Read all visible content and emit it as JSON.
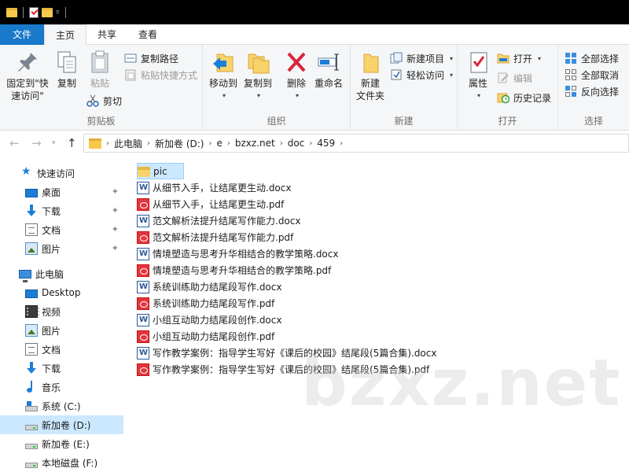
{
  "ribbon_tabs": [
    "文件",
    "主页",
    "共享",
    "查看"
  ],
  "clipboard": {
    "pin_label": "固定到\"快\n速访问\"",
    "copy_label": "复制",
    "paste_label": "粘贴",
    "copy_path": "复制路径",
    "paste_shortcut": "粘贴快捷方式",
    "cut": "剪切",
    "group": "剪贴板"
  },
  "organize": {
    "move_to": "移动到",
    "copy_to": "复制到",
    "delete": "删除",
    "rename": "重命名",
    "group": "组织"
  },
  "new": {
    "new_folder_1": "新建",
    "new_folder_2": "文件夹",
    "new_item": "新建项目",
    "easy_access": "轻松访问",
    "group": "新建"
  },
  "open": {
    "properties": "属性",
    "open": "打开",
    "edit": "编辑",
    "history": "历史记录",
    "group": "打开"
  },
  "select": {
    "select_all": "全部选择",
    "select_none": "全部取消",
    "invert": "反向选择",
    "group": "选择"
  },
  "breadcrumb": [
    "此电脑",
    "新加卷 (D:)",
    "e",
    "bzxz.net",
    "doc",
    "459"
  ],
  "nav": {
    "quick_access": "快速访问",
    "qa_items": [
      "桌面",
      "下载",
      "文档",
      "图片"
    ],
    "this_pc": "此电脑",
    "pc_items": [
      "Desktop",
      "视频",
      "图片",
      "文档",
      "下载",
      "音乐",
      "系统 (C:)",
      "新加卷 (D:)",
      "新加卷 (E:)",
      "本地磁盘 (F:)"
    ]
  },
  "files": [
    {
      "name": "pic",
      "type": "folder"
    },
    {
      "name": "从细节入手，让结尾更生动.docx",
      "type": "docx"
    },
    {
      "name": "从细节入手，让结尾更生动.pdf",
      "type": "pdf"
    },
    {
      "name": "范文解析法提升结尾写作能力.docx",
      "type": "docx"
    },
    {
      "name": "范文解析法提升结尾写作能力.pdf",
      "type": "pdf"
    },
    {
      "name": "情境塑造与思考升华相结合的教学策略.docx",
      "type": "docx"
    },
    {
      "name": "情境塑造与思考升华相结合的教学策略.pdf",
      "type": "pdf"
    },
    {
      "name": "系统训练助力结尾段写作.docx",
      "type": "docx"
    },
    {
      "name": "系统训练助力结尾段写作.pdf",
      "type": "pdf"
    },
    {
      "name": "小组互动助力结尾段创作.docx",
      "type": "docx"
    },
    {
      "name": "小组互动助力结尾段创作.pdf",
      "type": "pdf"
    },
    {
      "name": "写作教学案例：指导学生写好《课后的校园》结尾段(5篇合集).docx",
      "type": "docx"
    },
    {
      "name": "写作教学案例：指导学生写好《课后的校园》结尾段(5篇合集).pdf",
      "type": "pdf"
    }
  ],
  "watermark": "bzxz.net",
  "colors": {
    "accent": "#1979ca",
    "selection": "#cce8ff"
  }
}
